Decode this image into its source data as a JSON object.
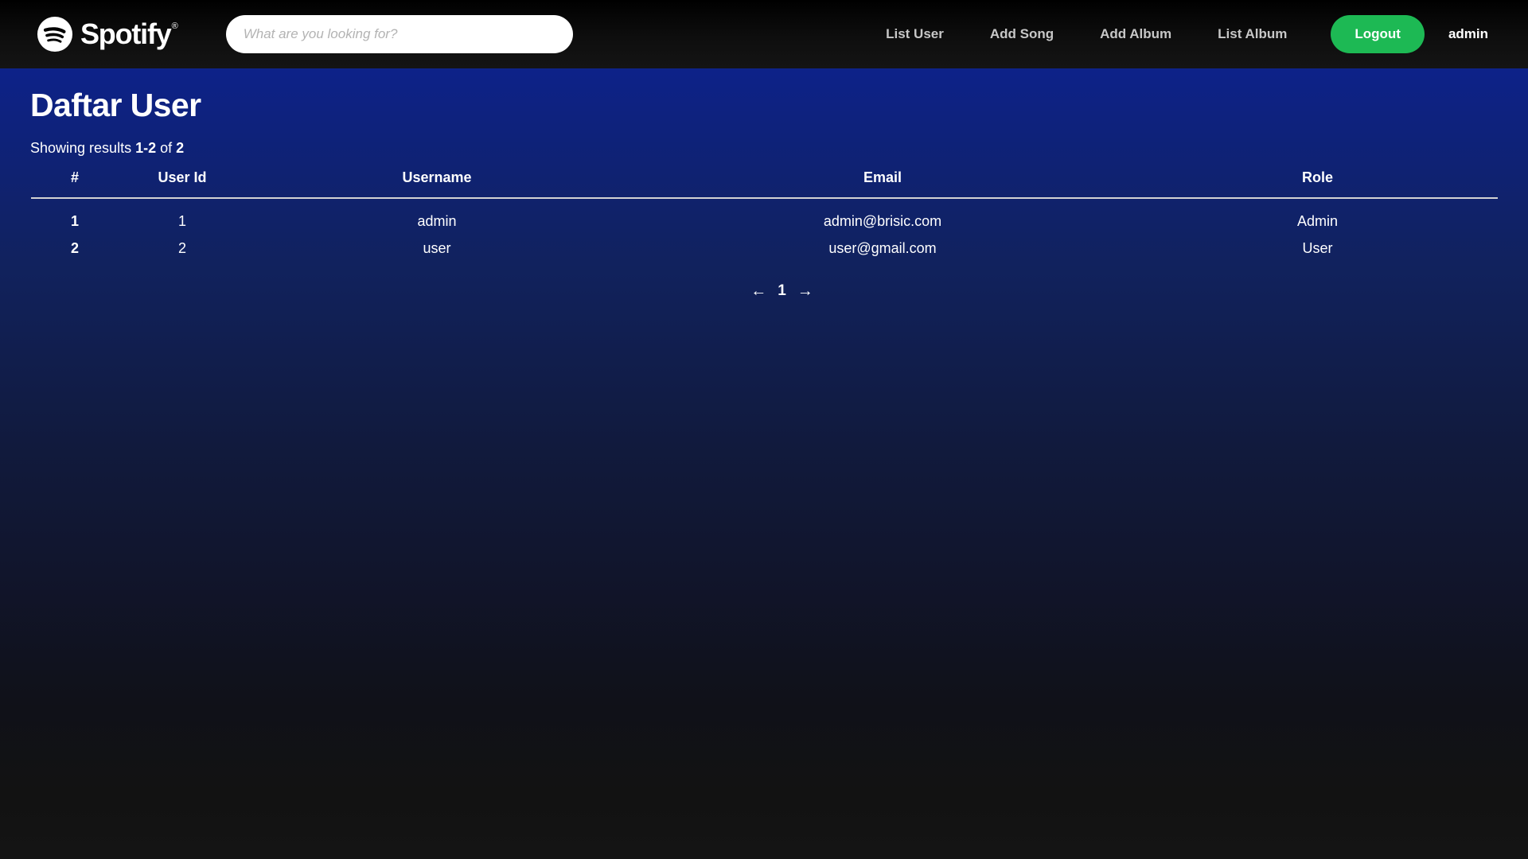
{
  "navbar": {
    "brand": {
      "name": "Spotify",
      "registered": "®",
      "icon": "spotify-logo-icon"
    },
    "search": {
      "value": "",
      "placeholder": "What are you looking for?"
    },
    "links": [
      {
        "label": "List User"
      },
      {
        "label": "Add Song"
      },
      {
        "label": "Add Album"
      },
      {
        "label": "List Album"
      }
    ],
    "logout_label": "Logout",
    "user_label": "admin"
  },
  "main": {
    "title": "Daftar User",
    "results": {
      "prefix": "Showing results ",
      "range": "1-2",
      "middle": " of ",
      "total": "2"
    },
    "table": {
      "headers": [
        "#",
        "User Id",
        "Username",
        "Email",
        "Role"
      ],
      "rows": [
        {
          "index": "1",
          "user_id": "1",
          "username": "admin",
          "email": "admin@brisic.com",
          "role": "Admin"
        },
        {
          "index": "2",
          "user_id": "2",
          "username": "user",
          "email": "user@gmail.com",
          "role": "User"
        }
      ]
    },
    "pagination": {
      "prev": "←",
      "current": "1",
      "next": "→"
    }
  },
  "colors": {
    "accent_green": "#1db954",
    "header_black": "#141414",
    "page_blue": "#0c2291"
  }
}
